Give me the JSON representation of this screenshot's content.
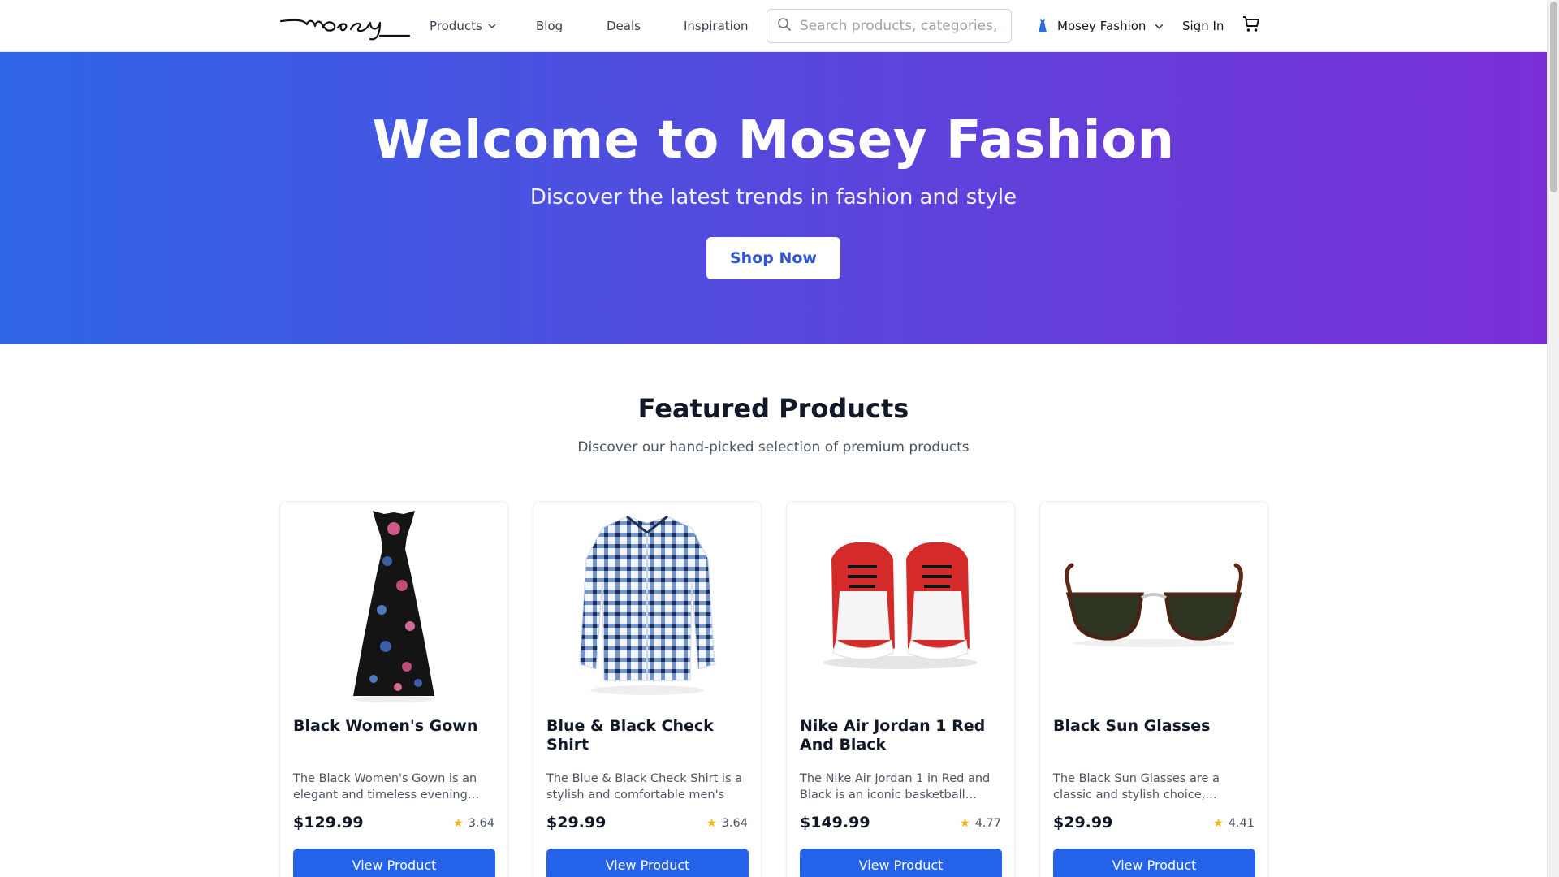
{
  "header": {
    "logo_icon": "mosey-wordmark-logo",
    "nav": {
      "products_label": "Products",
      "blog_label": "Blog",
      "deals_label": "Deals",
      "inspiration_label": "Inspiration"
    },
    "search": {
      "placeholder": "Search products, categories, a",
      "value": ""
    },
    "store_switch_label": "Mosey Fashion",
    "signin_label": "Sign In",
    "cart_icon": "cart-icon"
  },
  "hero": {
    "title": "Welcome to Mosey Fashion",
    "subtitle": "Discover the latest trends in fashion and style",
    "cta_label": "Shop Now",
    "gradient_start": "#2f66e6",
    "gradient_end": "#7a2fd6"
  },
  "featured": {
    "title": "Featured Products",
    "subtitle": "Discover our hand-picked selection of premium products",
    "products": [
      {
        "name": "Black Women's Gown",
        "description": "The Black Women's Gown is an elegant and timeless evening…",
        "price": "$129.99",
        "rating": "3.64",
        "button_label": "View Product",
        "image_icon": "gown-image"
      },
      {
        "name": "Blue & Black Check Shirt",
        "description": "The Blue & Black Check Shirt is a stylish and comfortable men's sh…",
        "price": "$29.99",
        "rating": "3.64",
        "button_label": "View Product",
        "image_icon": "shirt-image"
      },
      {
        "name": "Nike Air Jordan 1 Red And Black",
        "description": "The Nike Air Jordan 1 in Red and Black is an iconic basketball…",
        "price": "$149.99",
        "rating": "4.77",
        "button_label": "View Product",
        "image_icon": "sneakers-image"
      },
      {
        "name": "Black Sun Glasses",
        "description": "The Black Sun Glasses are a classic and stylish choice,…",
        "price": "$29.99",
        "rating": "4.41",
        "button_label": "View Product",
        "image_icon": "sunglasses-image"
      }
    ]
  },
  "colors": {
    "accent": "#2563eb",
    "star": "#f5b400"
  }
}
